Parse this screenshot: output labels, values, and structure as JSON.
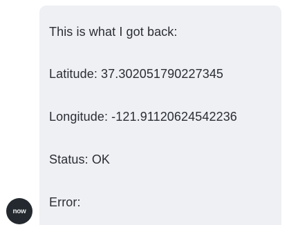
{
  "message": {
    "intro": "This is what I got back:",
    "latitude": "Latitude: 37.302051790227345",
    "longitude": "Longitude: -121.91120624542236",
    "status": "Status: OK",
    "error": "Error:"
  },
  "avatar": {
    "text": "now",
    "icon": "servicenow-logo-icon"
  },
  "colors": {
    "bubble": "#eef0f4",
    "text": "#2a2d33",
    "avatar": "#23292e"
  }
}
